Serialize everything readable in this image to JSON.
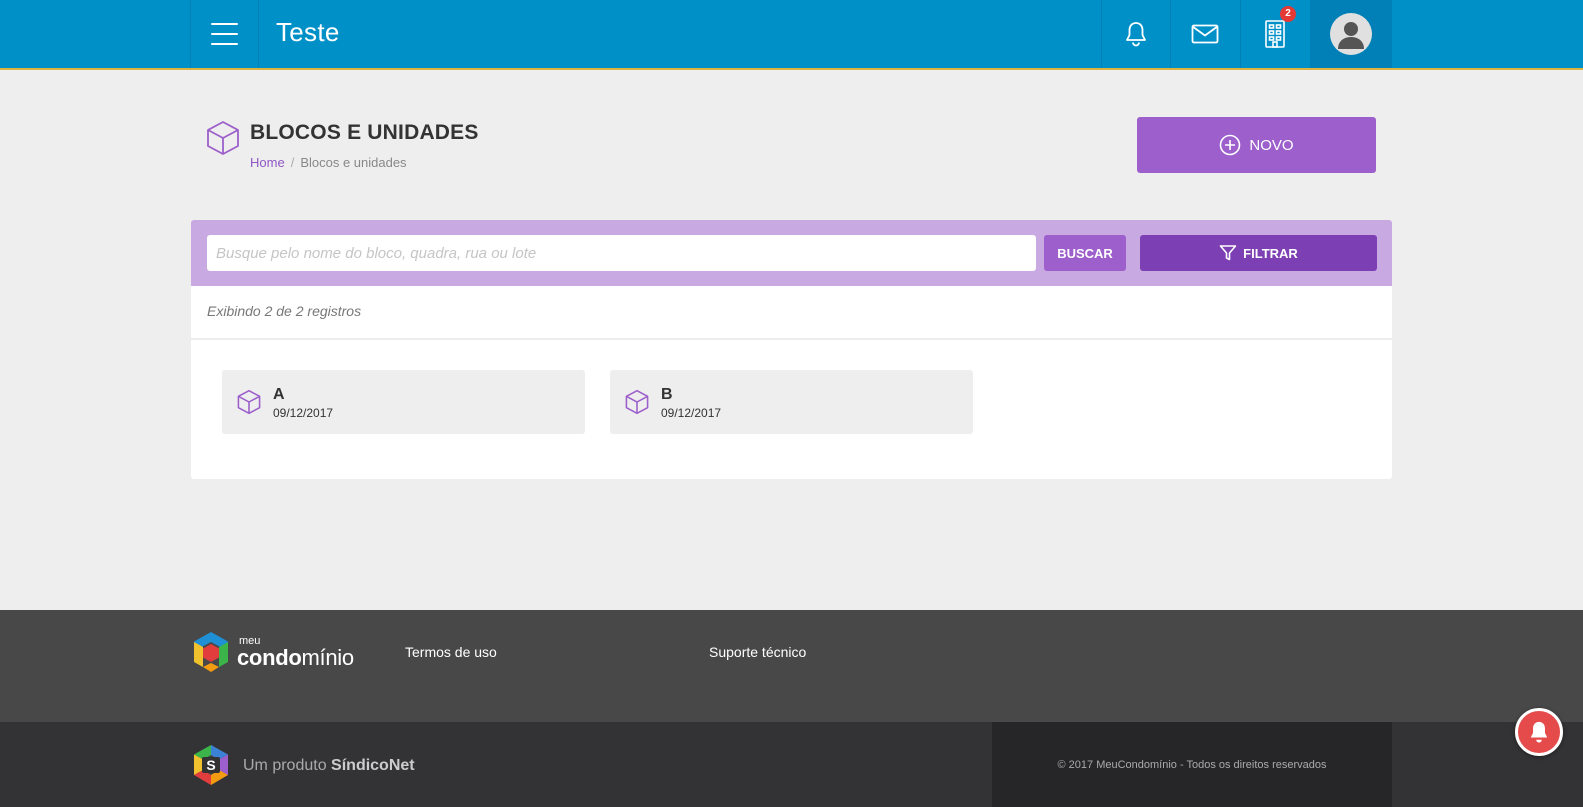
{
  "header": {
    "app_title": "Teste",
    "building_badge": "2",
    "colors": {
      "bar": "#0090c8",
      "accent_line": "#e0b341"
    }
  },
  "page": {
    "title": "BLOCOS E UNIDADES",
    "breadcrumb": {
      "home": "Home",
      "separator": "/",
      "current": "Blocos e unidades"
    },
    "new_button_label": "NOVO"
  },
  "search": {
    "placeholder": "Busque pelo nome do bloco, quadra, rua ou lote",
    "value": "",
    "search_button_label": "BUSCAR",
    "filter_button_label": "FILTRAR"
  },
  "results": {
    "count_text": "Exibindo 2 de 2 registros",
    "blocks": [
      {
        "name": "A",
        "date": "09/12/2017"
      },
      {
        "name": "B",
        "date": "09/12/2017"
      }
    ]
  },
  "footer": {
    "logo": {
      "meu": "meu",
      "condo_bold": "condo",
      "condo_light": "mínio"
    },
    "links": {
      "terms": "Termos de uso",
      "support": "Suporte técnico"
    },
    "product_prefix": "Um produto",
    "product_name": "SíndicoNet",
    "copyright": "© 2017 MeuCondomínio - Todos os direitos reservados"
  },
  "icons": [
    "menu-icon",
    "bell-icon",
    "mail-icon",
    "building-icon",
    "user-avatar-icon",
    "cube-icon",
    "plus-circle-icon",
    "filter-icon",
    "notification-bell-icon"
  ],
  "theme": {
    "purple": "#9c5fcb",
    "dark_purple": "#7c3fb4",
    "light_purple": "#c9a9e2"
  }
}
